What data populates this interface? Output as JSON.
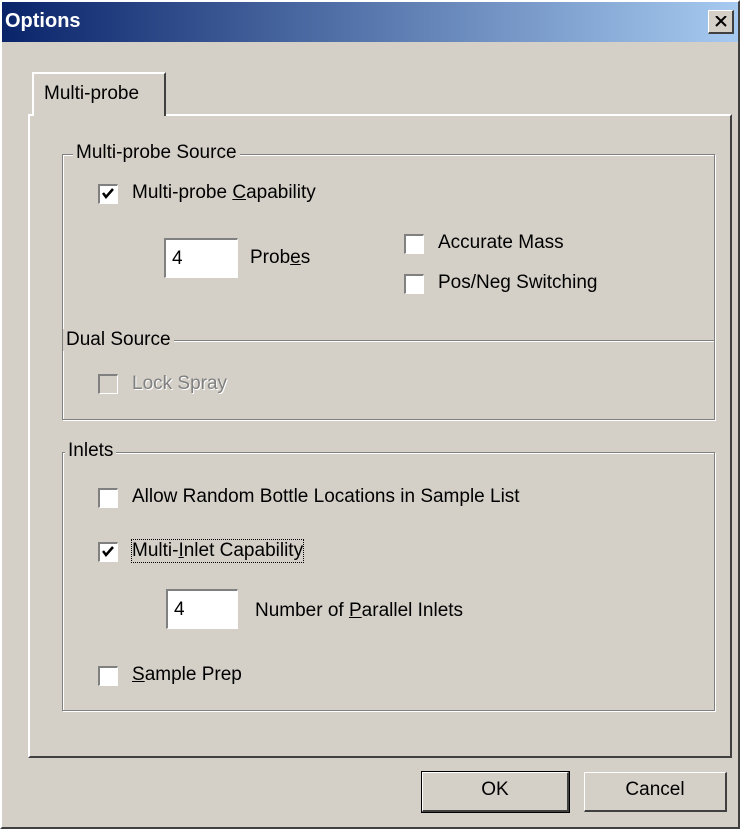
{
  "window": {
    "title": "Options"
  },
  "tabs": [
    {
      "label": "Multi-probe"
    }
  ],
  "multiprobe_source": {
    "legend": "Multi-probe Source",
    "capability": {
      "pre": "Multi-probe ",
      "mnemonic": "C",
      "post": "apability",
      "checked": true
    },
    "probes": {
      "value": "4",
      "pre": "Prob",
      "mnemonic": "e",
      "post": "s"
    },
    "accurate_mass": {
      "label": "Accurate Mass",
      "checked": false
    },
    "pos_neg": {
      "label": "Pos/Neg Switching",
      "checked": false
    }
  },
  "dual_source": {
    "legend": "Dual Source",
    "lock_spray": {
      "label": "Lock Spray",
      "checked": false,
      "enabled": false
    }
  },
  "inlets": {
    "legend": "Inlets",
    "random_bottle": {
      "label": "Allow Random Bottle Locations in Sample List",
      "checked": false
    },
    "multi_inlet": {
      "pre": "Multi-",
      "mnemonic": "I",
      "post": "nlet Capability",
      "checked": true
    },
    "parallel": {
      "value": "4",
      "pre": "Number of ",
      "mnemonic": "P",
      "post": "arallel Inlets"
    },
    "sample_prep": {
      "pre": "",
      "mnemonic": "S",
      "post": "ample Prep",
      "checked": false
    }
  },
  "buttons": {
    "ok": "OK",
    "cancel": "Cancel"
  },
  "colors": {
    "face": "#d4d0c8",
    "title_start": "#0a246a",
    "title_end": "#a6caf0"
  }
}
